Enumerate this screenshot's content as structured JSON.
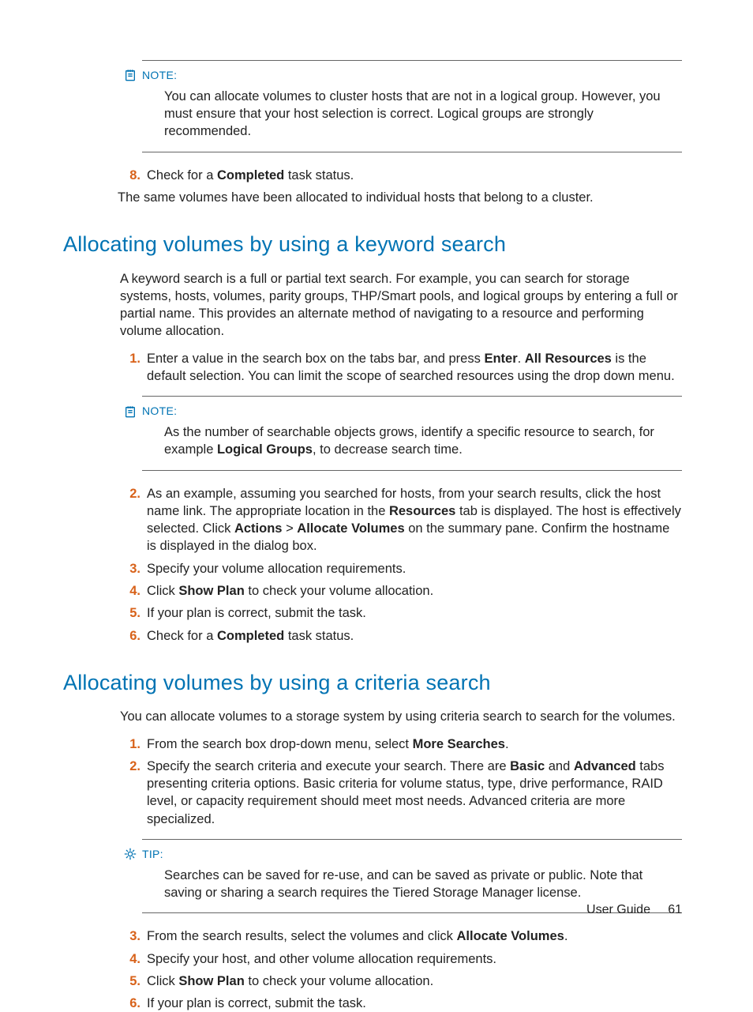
{
  "note1": {
    "label": "NOTE:",
    "body_parts": [
      "You can allocate volumes to cluster hosts that are not in a logical group. However, you must ensure that your host selection is correct. Logical groups are strongly recommended."
    ]
  },
  "top_steps": {
    "s8": {
      "num": "8.",
      "parts": [
        "Check for a ",
        "Completed",
        " task status."
      ]
    }
  },
  "top_outro": "The same volumes have been allocated to individual hosts that belong to a cluster.",
  "heading1": "Allocating volumes by using a keyword search",
  "sec1_intro": "A keyword search is a full or partial text search. For example, you can search for storage systems, hosts, volumes, parity groups, THP/Smart pools, and logical groups by entering a full or partial name. This provides an alternate method of navigating to a resource and performing volume allocation.",
  "sec1_step1": {
    "num": "1.",
    "parts": [
      "Enter a value in the search box on the tabs bar, and press ",
      "Enter",
      ". ",
      "All Resources",
      " is the default selection. You can limit the scope of searched resources using the drop down menu."
    ]
  },
  "note2": {
    "label": "NOTE:",
    "body_parts": [
      "As the number of searchable objects grows, identify a specific resource to search, for example ",
      "Logical Groups",
      ", to decrease search time."
    ]
  },
  "sec1_step2": {
    "num": "2.",
    "parts": [
      "As an example, assuming you searched for hosts, from your search results, click the host name link. The appropriate location in the ",
      "Resources",
      " tab is displayed. The host is effectively selected. Click ",
      "Actions",
      " > ",
      "Allocate Volumes",
      " on the summary pane. Confirm the hostname is displayed in the dialog box."
    ]
  },
  "sec1_step3": {
    "num": "3.",
    "parts": [
      "Specify your volume allocation requirements."
    ]
  },
  "sec1_step4": {
    "num": "4.",
    "parts": [
      "Click ",
      "Show Plan",
      " to check your volume allocation."
    ]
  },
  "sec1_step5": {
    "num": "5.",
    "parts": [
      "If your plan is correct, submit the task."
    ]
  },
  "sec1_step6": {
    "num": "6.",
    "parts": [
      "Check for a ",
      "Completed",
      " task status."
    ]
  },
  "heading2": "Allocating volumes by using a criteria search",
  "sec2_intro": "You can allocate volumes to a storage system by using criteria search to search for the volumes.",
  "sec2_step1": {
    "num": "1.",
    "parts": [
      "From the search box drop-down menu, select ",
      "More Searches",
      "."
    ]
  },
  "sec2_step2": {
    "num": "2.",
    "parts": [
      "Specify the search criteria and execute your search. There are ",
      "Basic",
      " and ",
      "Advanced",
      " tabs presenting criteria options. Basic criteria for volume status, type, drive performance, RAID level, or capacity requirement should meet most needs. Advanced criteria are more specialized."
    ]
  },
  "tip1": {
    "label": "TIP:",
    "body_parts": [
      "Searches can be saved for re-use, and can be saved as private or public. Note that saving or sharing a search requires the Tiered Storage Manager license."
    ]
  },
  "sec2_step3": {
    "num": "3.",
    "parts": [
      "From the search results, select the volumes and click ",
      "Allocate Volumes",
      "."
    ]
  },
  "sec2_step4": {
    "num": "4.",
    "parts": [
      "Specify your host, and other volume allocation requirements."
    ]
  },
  "sec2_step5": {
    "num": "5.",
    "parts": [
      "Click ",
      "Show Plan",
      " to check your volume allocation."
    ]
  },
  "sec2_step6": {
    "num": "6.",
    "parts": [
      "If your plan is correct, submit the task."
    ]
  },
  "footer_label": "User Guide",
  "footer_page": "61"
}
